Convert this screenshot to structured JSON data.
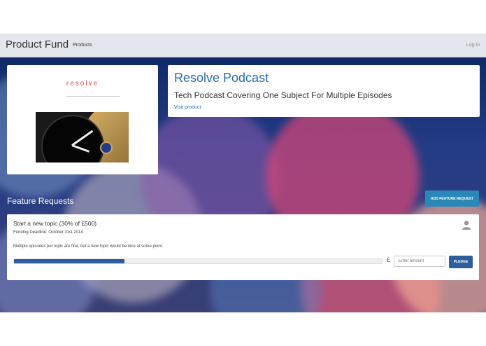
{
  "navbar": {
    "brand": "Product Fund",
    "products_link": "Products",
    "login_link": "Log in"
  },
  "product": {
    "image_logo_text": "resolve",
    "title": "Resolve Podcast",
    "subtitle": "Tech Podcast Covering One Subject For Multiple Episodes",
    "visit_link": "Visit product"
  },
  "features": {
    "heading": "Feature Requests",
    "add_button": "ADD FEATURE REQUEST",
    "items": [
      {
        "title": "Start a new topic (30% of £500)",
        "deadline": "Funding Deadline: October 31st 2014",
        "description": "Multiple episodes per topic are fine, but a new topic would be nice at some point.",
        "progress": 0.3,
        "currency": "£",
        "amount_placeholder": "Enter amount",
        "pledge_button": "PLEDGE"
      }
    ]
  },
  "colors": {
    "link": "#2a6db0",
    "button": "#2a88b8",
    "progress": "#2e5e9e"
  }
}
